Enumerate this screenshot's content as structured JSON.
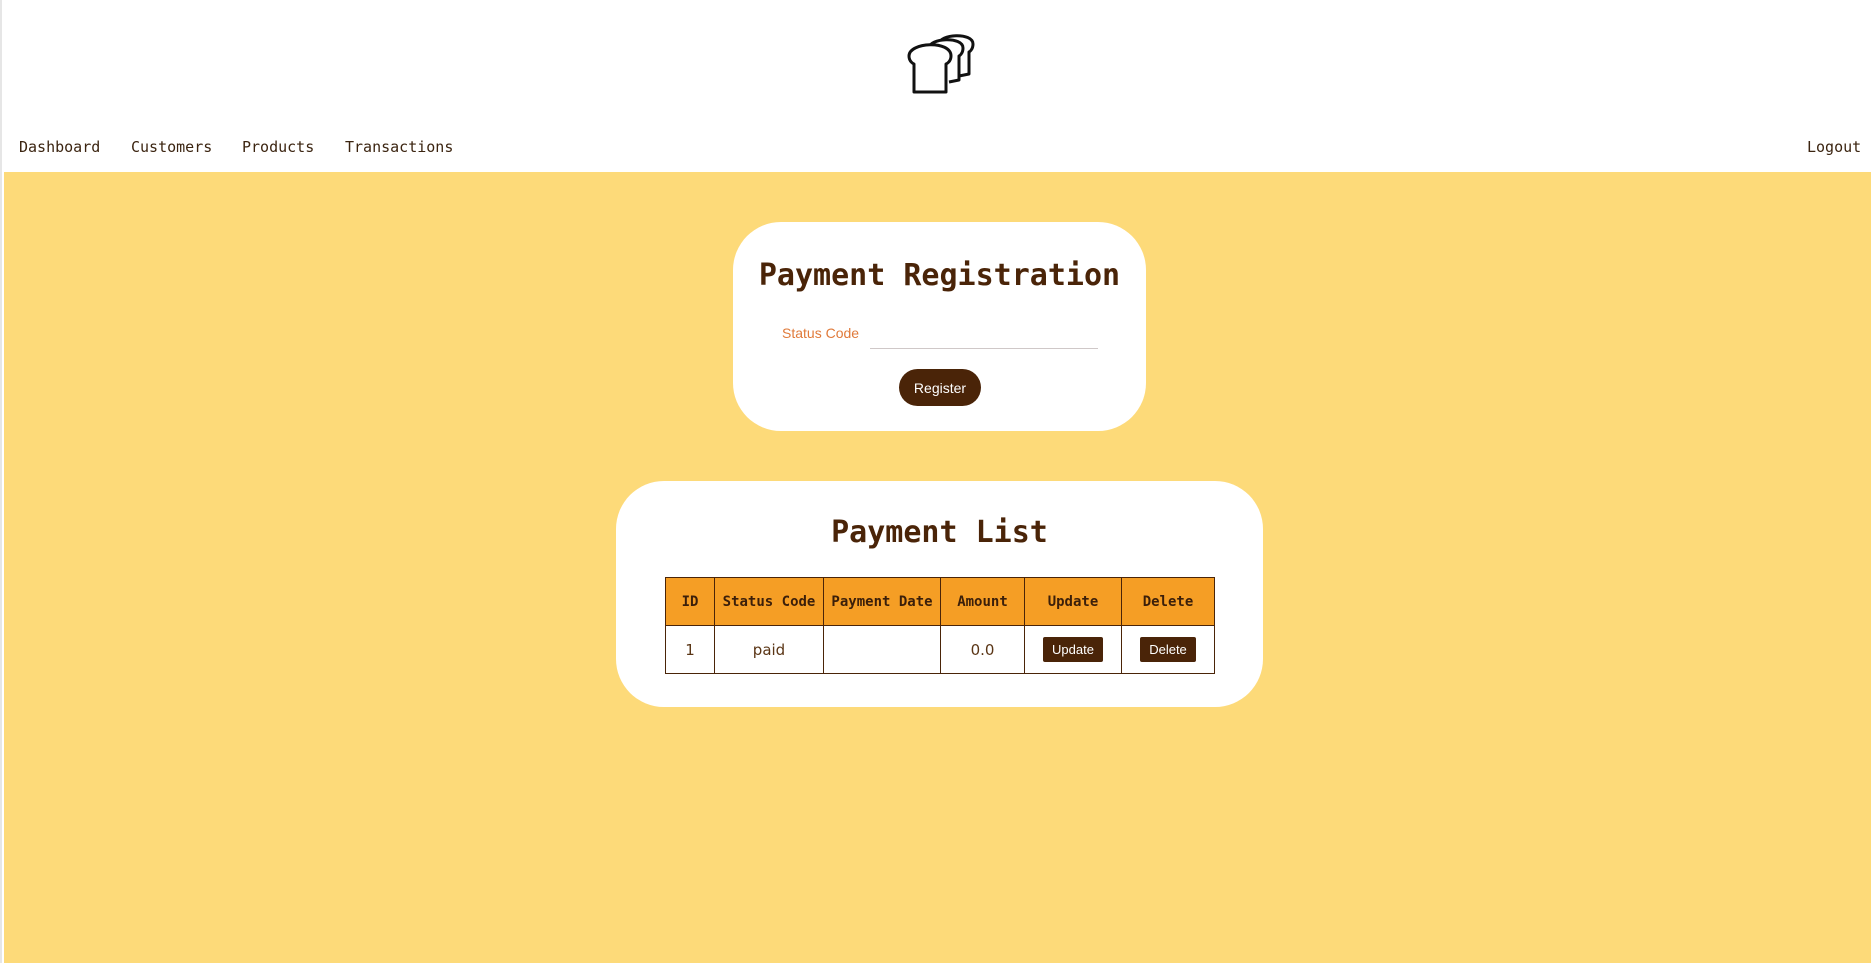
{
  "nav": {
    "dashboard": "Dashboard",
    "customers": "Customers",
    "products": "Products",
    "transactions": "Transactions",
    "logout": "Logout"
  },
  "registration": {
    "title": "Payment Registration",
    "status_label": "Status Code",
    "status_value": "",
    "register_label": "Register"
  },
  "list": {
    "title": "Payment List",
    "headers": [
      "ID",
      "Status Code",
      "Payment Date",
      "Amount",
      "Update",
      "Delete"
    ],
    "rows": [
      {
        "id": "1",
        "status_code": "paid",
        "payment_date": "",
        "amount": "0.0",
        "update_label": "Update",
        "delete_label": "Delete"
      }
    ]
  },
  "colors": {
    "background": "#fdda79",
    "accent": "#4a2408",
    "table_header": "#f59e25",
    "label": "#e07a3a"
  },
  "logo_icon": "bread-loaves-icon"
}
